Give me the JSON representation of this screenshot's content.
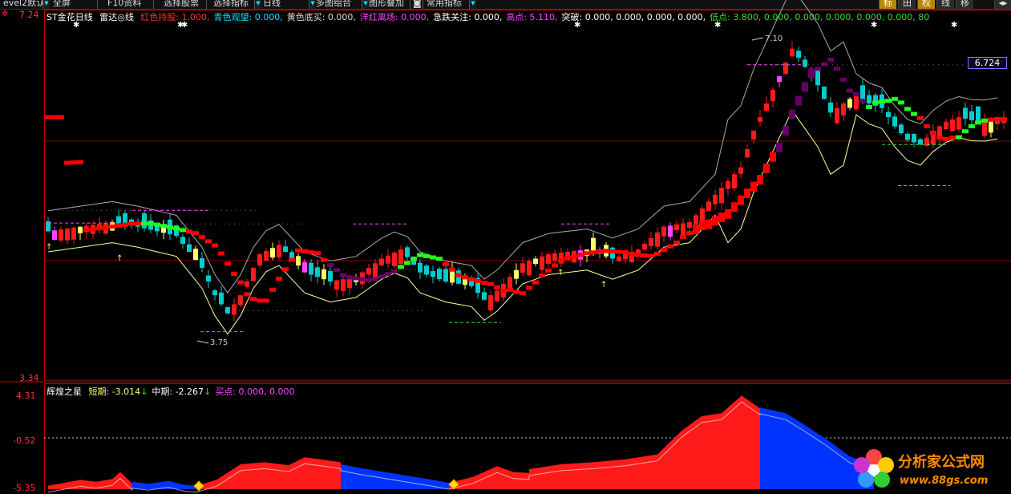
{
  "toolbar": {
    "items": [
      {
        "label": "evel2默认",
        "has_dropdown": true
      },
      {
        "label": "全屏",
        "has_dropdown": false
      },
      {
        "label": "F10资料",
        "has_dropdown": false
      },
      {
        "label": "选择股票",
        "has_dropdown": false
      },
      {
        "label": "选择指标",
        "has_dropdown": true
      },
      {
        "label": "日线",
        "has_dropdown": true
      },
      {
        "label": "多图组合",
        "has_dropdown": true
      },
      {
        "label": "图形叠加",
        "has_dropdown": false
      },
      {
        "label": "常用指标",
        "has_dropdown": true
      }
    ],
    "camera_icon": "camera-icon",
    "toggles": [
      {
        "label": "标",
        "active": true
      },
      {
        "label": "田",
        "active": false
      },
      {
        "label": "权",
        "active": true
      },
      {
        "label": "线",
        "active": false
      },
      {
        "label": "移",
        "active": false
      }
    ]
  },
  "main_chart": {
    "y_top_label": "7.24",
    "y_bottom_label": "3.34",
    "stock_name": "ST金花",
    "period": "日线",
    "indicator_name": "雷达",
    "legend": [
      {
        "text": "红色持股: 1.000,",
        "color": "#ff3333"
      },
      {
        "text": "青色观望: 0.000,",
        "color": "#00e5ff"
      },
      {
        "text": "黄色底买: 0.000,",
        "color": "#dddddd"
      },
      {
        "text": "洋红离场: 0.000,",
        "color": "#ff44ff"
      },
      {
        "text": "急跌关注: 0.000,",
        "color": "#ffffff"
      },
      {
        "text": "高点: 5.110,",
        "color": "#ff44ff"
      },
      {
        "text": "突破: 0.000, 0.000, 0.000, 0.000,",
        "color": "#ffffff"
      },
      {
        "text": "低点: 3.800, 0.000, 0.000, 0.000, 0.000, 0.000, 80",
        "color": "#33dd33"
      }
    ],
    "current_price": "6.724",
    "high_marker": "7.10",
    "low_marker": "3.75"
  },
  "sub_chart": {
    "title": "辉煌之星",
    "y_top_label": "4.31",
    "y_mid_label": "-0.52",
    "y_bottom_label": "-5.35",
    "legend": [
      {
        "label": "短期:",
        "value": "-3.014",
        "color": "#ffff66",
        "arrow": "↓"
      },
      {
        "label": "中期:",
        "value": "-2.267",
        "color": "#ffffff",
        "arrow": "↓"
      },
      {
        "label": "买点:",
        "value": "0.000, 0.000",
        "color": "#ff44ff",
        "arrow": ""
      }
    ]
  },
  "watermark": {
    "title": "分析家公式网",
    "url": "www.88gs.com"
  },
  "colors": {
    "up": "#ff1a1a",
    "down": "#00cccc",
    "magenta": "#ff44ff",
    "yellow_candle": "#ffff66",
    "band_upper": "#aaaaaa",
    "band_lower": "#ffff99",
    "radar_red": "#ff0000",
    "radar_green": "#22ff22",
    "radar_purple": "#660066",
    "area_red": "#ff1a1a",
    "area_blue": "#0033ff"
  }
}
